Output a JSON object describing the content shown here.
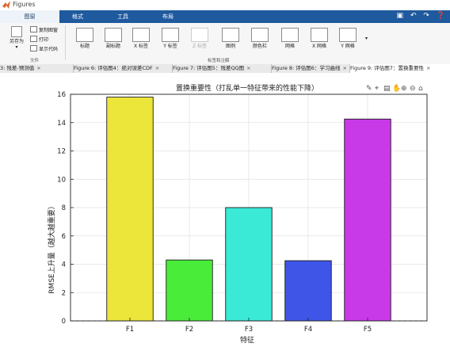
{
  "window": {
    "title": "Figures"
  },
  "toolstrip_tabs": [
    "图窗",
    "格式",
    "工具",
    "布局"
  ],
  "toolstrip_icons": [
    "save-icon",
    "undo-icon",
    "redo-icon",
    "help-icon"
  ],
  "ribbon": {
    "file_group": {
      "label": "文件",
      "save_as": "另存为",
      "copy_figure": "复制图窗",
      "print": "打印",
      "show_code": "显示代码"
    },
    "labels_group": {
      "label": "标签和注解",
      "buttons": [
        "标题",
        "副标题",
        "X 标签",
        "Y 标签",
        "Z 标签",
        "图例",
        "颜色栏",
        "网格",
        "X 网格",
        "Y 网格"
      ]
    }
  },
  "figure_tabs": [
    {
      "label": "3: 残差-预测值"
    },
    {
      "label": "Figure 6: 评估图4：绝对误差CDF"
    },
    {
      "label": "Figure 7: 评估图5：残差QQ图"
    },
    {
      "label": "Figure 8: 评估图6：学习曲线"
    },
    {
      "label": "Figure 9: 评估图7：置换重要性"
    }
  ],
  "axes_toolbar_icons": [
    "brush-icon",
    "datatip-icon",
    "save-icon",
    "pan-icon",
    "zoom-in-icon",
    "zoom-out-icon",
    "home-icon"
  ],
  "chart_data": {
    "type": "bar",
    "title": "置换重要性（打乱单一特征带来的性能下降）",
    "xlabel": "特征",
    "ylabel": "RMSE上升量（越大越重要）",
    "categories": [
      "F1",
      "F2",
      "F3",
      "F4",
      "F5"
    ],
    "values": [
      15.8,
      4.3,
      8.0,
      4.25,
      14.25
    ],
    "colors": [
      "#ece53a",
      "#4aec3a",
      "#3ae9d6",
      "#3e55e8",
      "#c83ae8"
    ],
    "ylim": [
      0,
      16
    ],
    "yticks": [
      0,
      2,
      4,
      6,
      8,
      10,
      12,
      14,
      16
    ],
    "grid": true,
    "baseline": 0
  }
}
